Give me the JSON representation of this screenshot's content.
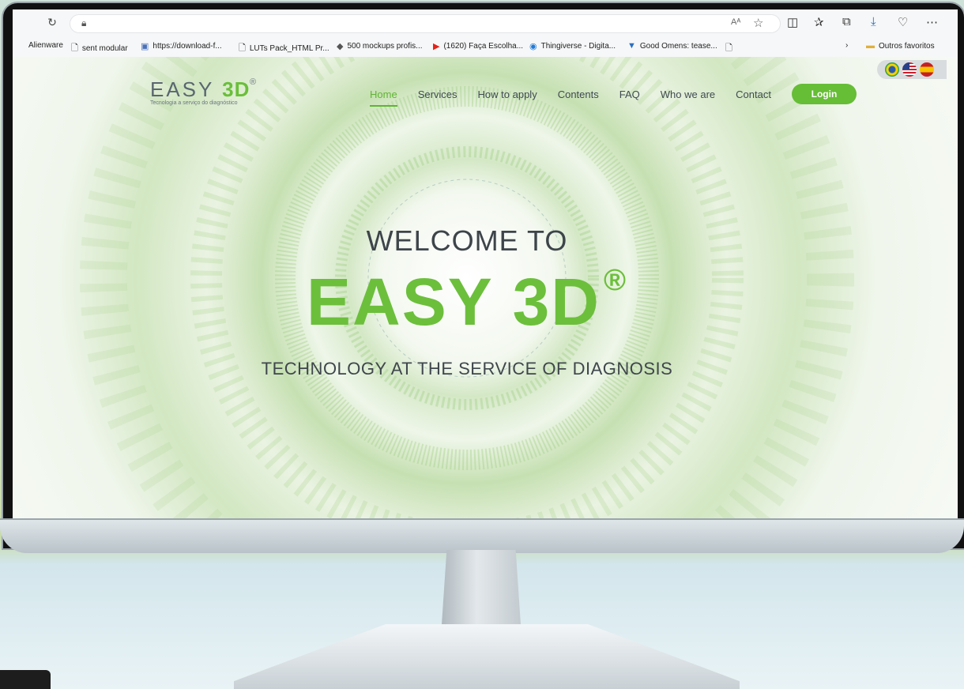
{
  "browser": {
    "address_value": "",
    "read_aloud_label": "Aᴬ",
    "bookmarks": [
      {
        "label": "Alienware",
        "icon": "bookmark-generic"
      },
      {
        "label": "sent modular",
        "icon": "page-icon"
      },
      {
        "label": "https://download-f...",
        "icon": "page-icon"
      },
      {
        "label": "LUTs Pack_HTML Pr...",
        "icon": "page-icon"
      },
      {
        "label": "500 mockups profis...",
        "icon": "diamond-icon"
      },
      {
        "label": "(1620) Faça Escolha...",
        "icon": "youtube-icon"
      },
      {
        "label": "Thingiverse - Digita...",
        "icon": "thingiverse-icon"
      },
      {
        "label": "Good Omens: tease...",
        "icon": "trophy-icon"
      },
      {
        "label": "",
        "icon": "page-icon"
      }
    ],
    "other_favorites": "Outros favoritos"
  },
  "site": {
    "logo_text_main": "EASY",
    "logo_text_accent": "3D",
    "logo_reg": "®",
    "logo_tagline": "Tecnologia a serviço do diagnóstico",
    "nav": [
      "Home",
      "Services",
      "How to apply",
      "Contents",
      "FAQ",
      "Who we are",
      "Contact"
    ],
    "login": "Login",
    "flags": [
      "brazil",
      "usa",
      "spain"
    ],
    "hero": {
      "welcome": "WELCOME TO",
      "brand": "EASY 3D",
      "brand_reg": "®",
      "subtitle": "TECHNOLOGY AT THE SERVICE OF DIAGNOSIS"
    }
  },
  "colors": {
    "accent_green": "#66bd36",
    "text_dark": "#3f4a52"
  }
}
